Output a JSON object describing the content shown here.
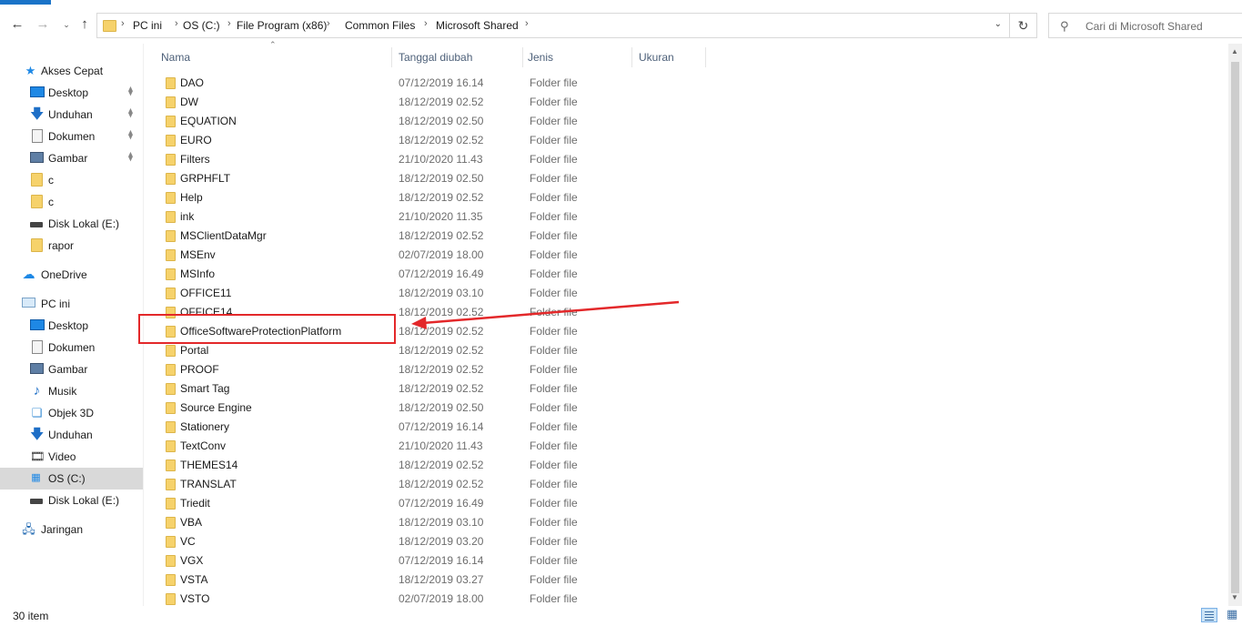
{
  "nav": {
    "back_icon": "arrow-left-icon",
    "forward_icon": "arrow-right-icon",
    "up_icon": "arrow-up-icon",
    "breadcrumbs": [
      "PC ini",
      "OS (C:)",
      "File Program (x86)",
      "Common Files",
      "Microsoft Shared"
    ],
    "search_placeholder": "Cari di Microsoft Shared"
  },
  "sidebar": {
    "items": [
      {
        "label": "Akses Cepat",
        "icon": "star-icon"
      },
      {
        "label": "Desktop",
        "icon": "desktop-icon",
        "pinned": true
      },
      {
        "label": "Unduhan",
        "icon": "download-icon",
        "pinned": true
      },
      {
        "label": "Dokumen",
        "icon": "document-icon",
        "pinned": true
      },
      {
        "label": "Gambar",
        "icon": "pictures-icon",
        "pinned": true
      },
      {
        "label": "c",
        "icon": "folder-icon"
      },
      {
        "label": "c",
        "icon": "folder-icon"
      },
      {
        "label": "Disk Lokal (E:)",
        "icon": "drive-icon"
      },
      {
        "label": "rapor",
        "icon": "folder-icon"
      },
      {
        "label": "OneDrive",
        "icon": "cloud-icon"
      },
      {
        "label": "PC ini",
        "icon": "computer-icon"
      },
      {
        "label": "Desktop",
        "icon": "desktop-icon"
      },
      {
        "label": "Dokumen",
        "icon": "document-icon"
      },
      {
        "label": "Gambar",
        "icon": "pictures-icon"
      },
      {
        "label": "Musik",
        "icon": "music-icon"
      },
      {
        "label": "Objek 3D",
        "icon": "cube-icon"
      },
      {
        "label": "Unduhan",
        "icon": "download-icon"
      },
      {
        "label": "Video",
        "icon": "video-icon"
      },
      {
        "label": "OS (C:)",
        "icon": "windows-drive-icon",
        "selected": true
      },
      {
        "label": "Disk Lokal (E:)",
        "icon": "drive-icon"
      },
      {
        "label": "Jaringan",
        "icon": "network-icon"
      }
    ]
  },
  "columns": {
    "name": "Nama",
    "date": "Tanggal diubah",
    "type": "Jenis",
    "size": "Ukuran"
  },
  "files": [
    {
      "name": "DAO",
      "date": "07/12/2019 16.14",
      "type": "Folder file"
    },
    {
      "name": "DW",
      "date": "18/12/2019 02.52",
      "type": "Folder file"
    },
    {
      "name": "EQUATION",
      "date": "18/12/2019 02.50",
      "type": "Folder file"
    },
    {
      "name": "EURO",
      "date": "18/12/2019 02.52",
      "type": "Folder file"
    },
    {
      "name": "Filters",
      "date": "21/10/2020 11.43",
      "type": "Folder file"
    },
    {
      "name": "GRPHFLT",
      "date": "18/12/2019 02.50",
      "type": "Folder file"
    },
    {
      "name": "Help",
      "date": "18/12/2019 02.52",
      "type": "Folder file"
    },
    {
      "name": "ink",
      "date": "21/10/2020 11.35",
      "type": "Folder file"
    },
    {
      "name": "MSClientDataMgr",
      "date": "18/12/2019 02.52",
      "type": "Folder file"
    },
    {
      "name": "MSEnv",
      "date": "02/07/2019 18.00",
      "type": "Folder file"
    },
    {
      "name": "MSInfo",
      "date": "07/12/2019 16.49",
      "type": "Folder file"
    },
    {
      "name": "OFFICE11",
      "date": "18/12/2019 03.10",
      "type": "Folder file"
    },
    {
      "name": "OFFICE14",
      "date": "18/12/2019 02.52",
      "type": "Folder file"
    },
    {
      "name": "OfficeSoftwareProtectionPlatform",
      "date": "18/12/2019 02.52",
      "type": "Folder file"
    },
    {
      "name": "Portal",
      "date": "18/12/2019 02.52",
      "type": "Folder file"
    },
    {
      "name": "PROOF",
      "date": "18/12/2019 02.52",
      "type": "Folder file"
    },
    {
      "name": "Smart Tag",
      "date": "18/12/2019 02.52",
      "type": "Folder file"
    },
    {
      "name": "Source Engine",
      "date": "18/12/2019 02.50",
      "type": "Folder file"
    },
    {
      "name": "Stationery",
      "date": "07/12/2019 16.14",
      "type": "Folder file"
    },
    {
      "name": "TextConv",
      "date": "21/10/2020 11.43",
      "type": "Folder file"
    },
    {
      "name": "THEMES14",
      "date": "18/12/2019 02.52",
      "type": "Folder file"
    },
    {
      "name": "TRANSLAT",
      "date": "18/12/2019 02.52",
      "type": "Folder file"
    },
    {
      "name": "Triedit",
      "date": "07/12/2019 16.49",
      "type": "Folder file"
    },
    {
      "name": "VBA",
      "date": "18/12/2019 03.10",
      "type": "Folder file"
    },
    {
      "name": "VC",
      "date": "18/12/2019 03.20",
      "type": "Folder file"
    },
    {
      "name": "VGX",
      "date": "07/12/2019 16.14",
      "type": "Folder file"
    },
    {
      "name": "VSTA",
      "date": "18/12/2019 03.27",
      "type": "Folder file"
    },
    {
      "name": "VSTO",
      "date": "02/07/2019 18.00",
      "type": "Folder file"
    }
  ],
  "status": {
    "item_count": "30 item"
  },
  "colors": {
    "folder": "#f6d26b",
    "annotation": "#e3282a",
    "selection": "#d9d9d9",
    "header_text": "#4d6079"
  }
}
